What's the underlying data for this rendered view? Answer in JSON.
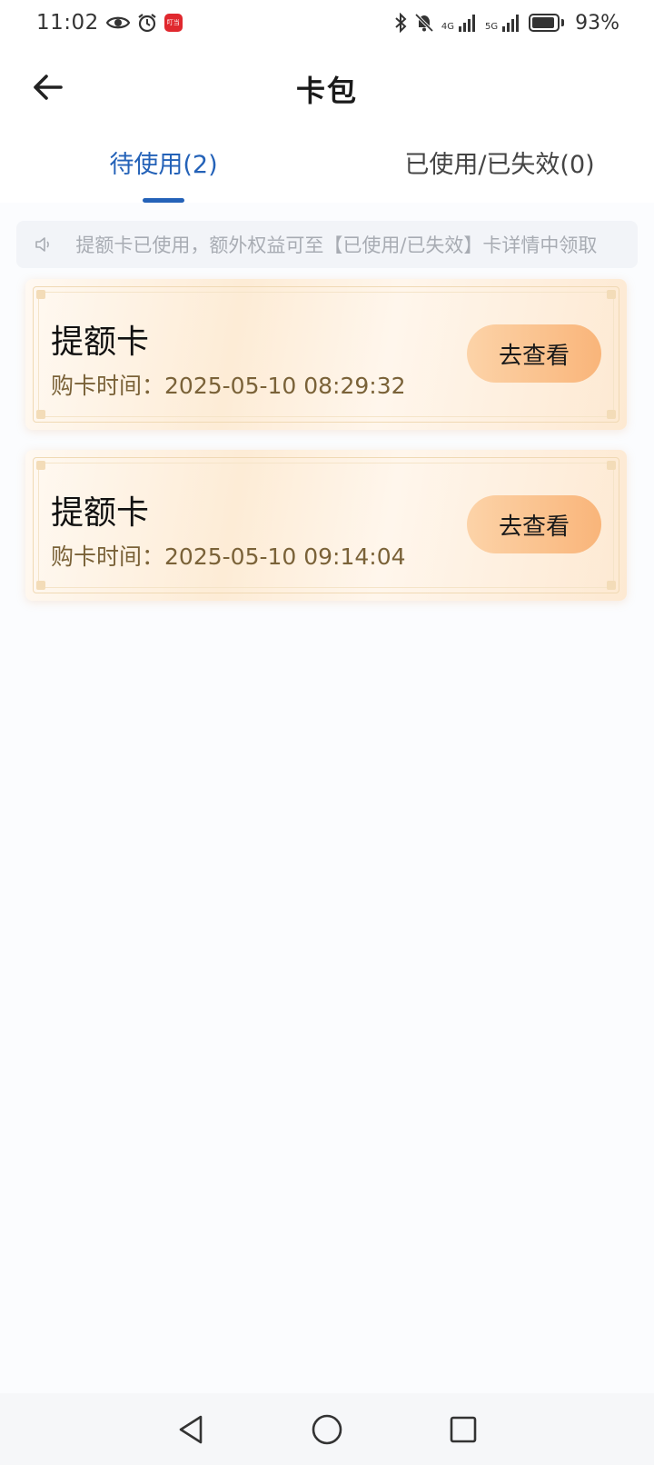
{
  "status_bar": {
    "time": "11:02",
    "app_badge": "叮当",
    "signal_1_label": "4G",
    "signal_2_label": "5G",
    "battery_level": 0.93,
    "battery_text": "93%",
    "icons": [
      "eye-icon",
      "alarm-icon",
      "bluetooth-icon",
      "bell-muted-icon",
      "signal-icon",
      "battery-icon"
    ]
  },
  "header": {
    "title": "卡包",
    "back_icon": "arrow-left-icon"
  },
  "tabs": [
    {
      "label": "待使用(2)",
      "active": true
    },
    {
      "label": "已使用/已失效(0)",
      "active": false
    }
  ],
  "notice": {
    "text": "ﾠ提额卡已使用，额外权益可至【已使用/已失效】卡详情中领取",
    "icon": "speaker-icon"
  },
  "cards": [
    {
      "title": "提额卡",
      "time_label": "购卡时间：",
      "time_value": "2025-05-10 08:29:32",
      "button_label": "去查看"
    },
    {
      "title": "提额卡",
      "time_label": "购卡时间：",
      "time_value": "2025-05-10 09:14:04",
      "button_label": "去查看"
    }
  ],
  "nav_bar": {
    "icons": [
      "back-triangle-icon",
      "home-circle-icon",
      "recents-square-icon"
    ]
  },
  "colors": {
    "accent": "#2462b8",
    "button_gradient_start": "#fcd3a8",
    "button_gradient_end": "#f9b57a",
    "time_text": "#7a6238"
  }
}
